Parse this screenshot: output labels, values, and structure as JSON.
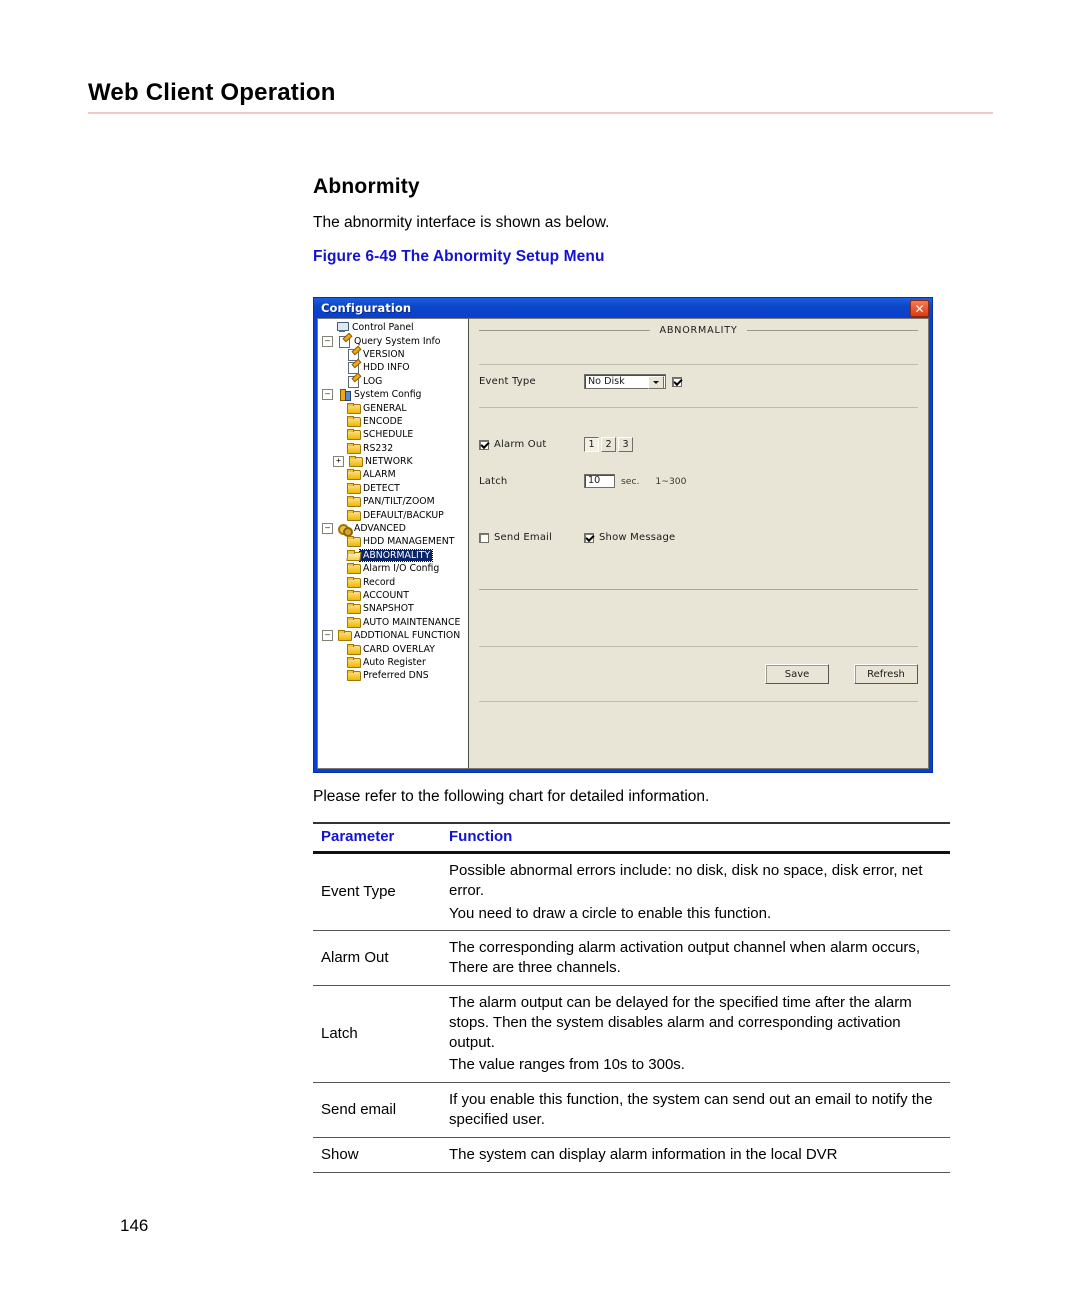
{
  "page": {
    "running_head": "Web Client Operation",
    "number": "146"
  },
  "content": {
    "section_title": "Abnormity",
    "intro": "The abnormity interface is shown as below.",
    "figure_caption": "Figure 6-49 The Abnormity Setup Menu",
    "after_figure": "Please refer to the following chart for detailed information."
  },
  "dialog": {
    "title": "Configuration",
    "close_label": "✕",
    "panel_header": "ABNORMALITY",
    "tree": [
      {
        "label": "Control Panel",
        "depth": 0,
        "icon": "monitor-icon",
        "expander": "",
        "selected": false
      },
      {
        "label": "Query System Info",
        "depth": 0,
        "icon": "note-icon",
        "expander": "–",
        "selected": false
      },
      {
        "label": "VERSION",
        "depth": 1,
        "icon": "note-icon",
        "expander": "",
        "selected": false
      },
      {
        "label": "HDD INFO",
        "depth": 1,
        "icon": "note-icon",
        "expander": "",
        "selected": false
      },
      {
        "label": "LOG",
        "depth": 1,
        "icon": "note-icon",
        "expander": "",
        "selected": false
      },
      {
        "label": "System Config",
        "depth": 0,
        "icon": "sysconfig-icon",
        "expander": "–",
        "selected": false
      },
      {
        "label": "GENERAL",
        "depth": 1,
        "icon": "folder-icon",
        "expander": "",
        "selected": false
      },
      {
        "label": "ENCODE",
        "depth": 1,
        "icon": "folder-icon",
        "expander": "",
        "selected": false
      },
      {
        "label": "SCHEDULE",
        "depth": 1,
        "icon": "folder-icon",
        "expander": "",
        "selected": false
      },
      {
        "label": "RS232",
        "depth": 1,
        "icon": "folder-icon",
        "expander": "",
        "selected": false
      },
      {
        "label": "NETWORK",
        "depth": 1,
        "icon": "folder-icon",
        "expander": "+",
        "selected": false
      },
      {
        "label": "ALARM",
        "depth": 1,
        "icon": "folder-icon",
        "expander": "",
        "selected": false
      },
      {
        "label": "DETECT",
        "depth": 1,
        "icon": "folder-icon",
        "expander": "",
        "selected": false
      },
      {
        "label": "PAN/TILT/ZOOM",
        "depth": 1,
        "icon": "folder-icon",
        "expander": "",
        "selected": false
      },
      {
        "label": "DEFAULT/BACKUP",
        "depth": 1,
        "icon": "folder-icon",
        "expander": "",
        "selected": false
      },
      {
        "label": "ADVANCED",
        "depth": 0,
        "icon": "gears-icon",
        "expander": "–",
        "selected": false
      },
      {
        "label": "HDD MANAGEMENT",
        "depth": 1,
        "icon": "folder-icon",
        "expander": "",
        "selected": false
      },
      {
        "label": "ABNORMALITY",
        "depth": 1,
        "icon": "folder-open-icon",
        "expander": "",
        "selected": true
      },
      {
        "label": "Alarm I/O Config",
        "depth": 1,
        "icon": "folder-icon",
        "expander": "",
        "selected": false
      },
      {
        "label": "Record",
        "depth": 1,
        "icon": "folder-icon",
        "expander": "",
        "selected": false
      },
      {
        "label": "ACCOUNT",
        "depth": 1,
        "icon": "folder-icon",
        "expander": "",
        "selected": false
      },
      {
        "label": "SNAPSHOT",
        "depth": 1,
        "icon": "folder-icon",
        "expander": "",
        "selected": false
      },
      {
        "label": "AUTO MAINTENANCE",
        "depth": 1,
        "icon": "folder-icon",
        "expander": "",
        "selected": false
      },
      {
        "label": "ADDTIONAL FUNCTION",
        "depth": 0,
        "icon": "folder-icon",
        "expander": "–",
        "selected": false
      },
      {
        "label": "CARD OVERLAY",
        "depth": 1,
        "icon": "folder-icon",
        "expander": "",
        "selected": false
      },
      {
        "label": "Auto Register",
        "depth": 1,
        "icon": "folder-icon",
        "expander": "",
        "selected": false
      },
      {
        "label": "Preferred DNS",
        "depth": 1,
        "icon": "folder-icon",
        "expander": "",
        "selected": false
      }
    ],
    "form": {
      "event_type_label": "Event Type",
      "event_type_value": "No Disk",
      "event_type_enabled": true,
      "alarm_out_label": "Alarm Out",
      "alarm_out_checked": true,
      "channels": [
        "1",
        "2",
        "3"
      ],
      "channel_active": "1",
      "latch_label": "Latch",
      "latch_value": "10",
      "latch_unit": "sec.",
      "latch_range": "1~300",
      "send_email_label": "Send Email",
      "send_email_checked": false,
      "show_message_label": "Show Message",
      "show_message_checked": true,
      "save_label": "Save",
      "refresh_label": "Refresh"
    }
  },
  "table": {
    "headers": [
      "Parameter",
      "Function"
    ],
    "rows": [
      {
        "parameter": "Event Type",
        "lines": [
          "Possible abnormal errors include: no disk, disk no space, disk error, net error.",
          "You need to draw a circle to enable this function."
        ]
      },
      {
        "parameter": "Alarm Out",
        "lines": [
          "The corresponding alarm activation output channel when alarm occurs, There are three channels."
        ]
      },
      {
        "parameter": "Latch",
        "lines": [
          "The alarm output can be delayed for the specified time after the alarm stops. Then the system disables alarm and corresponding activation output.",
          "The value ranges from 10s to 300s."
        ]
      },
      {
        "parameter": "Send email",
        "lines": [
          "If you enable this function, the system can send out an email to notify the specified user."
        ]
      },
      {
        "parameter": "Show",
        "lines": [
          "The system can display alarm information in the local DVR"
        ]
      }
    ]
  },
  "colors": {
    "accent_blue": "#1414d0",
    "rule_pink": "#f6c9c9",
    "title_bar": "#0a3fd0",
    "panel_bg": "#e8e5d6",
    "selection": "#0a246a"
  }
}
